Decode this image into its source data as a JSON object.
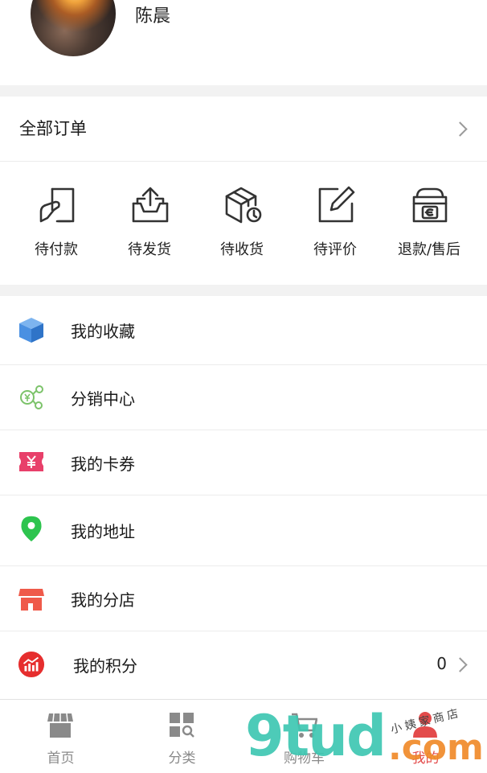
{
  "header": {
    "username": "陈晨"
  },
  "orders": {
    "all_label": "全部订单",
    "statuses": [
      {
        "label": "待付款",
        "icon": "payment-pending-icon"
      },
      {
        "label": "待发货",
        "icon": "ship-pending-icon"
      },
      {
        "label": "待收货",
        "icon": "receive-pending-icon"
      },
      {
        "label": "待评价",
        "icon": "review-pending-icon"
      },
      {
        "label": "退款/售后",
        "icon": "refund-aftersale-icon"
      }
    ]
  },
  "menu": {
    "items": [
      {
        "label": "我的收藏",
        "icon": "favorites-cube-icon",
        "color": "#4a90e2"
      },
      {
        "label": "分销中心",
        "icon": "distribution-icon",
        "color": "#7cc36a"
      },
      {
        "label": "我的卡券",
        "icon": "coupon-icon",
        "color": "#e8406a"
      },
      {
        "label": "我的地址",
        "icon": "location-pin-icon",
        "color": "#2dc44e"
      },
      {
        "label": "我的分店",
        "icon": "store-icon",
        "color": "#ef5a4a"
      },
      {
        "label": "我的积分",
        "icon": "points-chart-icon",
        "color": "#e62e2e",
        "value": "0"
      }
    ]
  },
  "tabbar": {
    "tabs": [
      {
        "label": "首页",
        "icon": "store-front-icon"
      },
      {
        "label": "分类",
        "icon": "category-grid-icon"
      },
      {
        "label": "购物车",
        "icon": "cart-icon"
      },
      {
        "label": "我的",
        "icon": "user-icon",
        "active": true
      }
    ],
    "active_color": "#e34b4b",
    "inactive_color": "#8a8a8a"
  },
  "watermark": {
    "main": "9tud",
    "suffix": ".com",
    "small": "小姨家商店"
  }
}
